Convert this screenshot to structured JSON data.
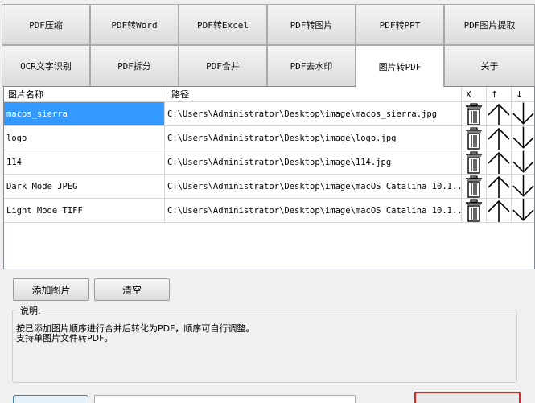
{
  "tabs_row1": [
    {
      "label": "PDF压缩"
    },
    {
      "label": "PDF转Word"
    },
    {
      "label": "PDF转Excel"
    },
    {
      "label": "PDF转图片"
    },
    {
      "label": "PDF转PPT"
    },
    {
      "label": "PDF图片提取"
    }
  ],
  "tabs_row2": [
    {
      "label": "OCR文字识别"
    },
    {
      "label": "PDF拆分"
    },
    {
      "label": "PDF合并"
    },
    {
      "label": "PDF去水印"
    },
    {
      "label": "图片转PDF",
      "active": true
    },
    {
      "label": "关于"
    }
  ],
  "grid": {
    "headers": {
      "name": "图片名称",
      "path": "路径",
      "delete": "X",
      "up": "↑",
      "down": "↓"
    },
    "rows": [
      {
        "name": "macos_sierra",
        "path": "C:\\Users\\Administrator\\Desktop\\image\\macos_sierra.jpg",
        "selected": true
      },
      {
        "name": "logo",
        "path": "C:\\Users\\Administrator\\Desktop\\image\\logo.jpg"
      },
      {
        "name": "114",
        "path": "C:\\Users\\Administrator\\Desktop\\image\\114.jpg"
      },
      {
        "name": "Dark Mode JPEG",
        "path": "C:\\Users\\Administrator\\Desktop\\image\\macOS Catalina 10.1..."
      },
      {
        "name": "Light Mode TIFF",
        "path": "C:\\Users\\Administrator\\Desktop\\image\\macOS Catalina 10.1..."
      }
    ]
  },
  "buttons": {
    "add": "添加图片",
    "clear": "清空"
  },
  "description": {
    "legend": "说明:",
    "line1": "按已添加图片顺序进行合并后转化为PDF，顺序可自行调整。",
    "line2": "支持单图片文件转PDF。"
  },
  "colors": {
    "selection": "#3399ff",
    "highlight_border": "#d9261c",
    "focus_border": "#3c7fb1"
  },
  "icons": {
    "delete": "trash-icon",
    "up": "arrow-up-icon",
    "down": "arrow-down-icon"
  }
}
